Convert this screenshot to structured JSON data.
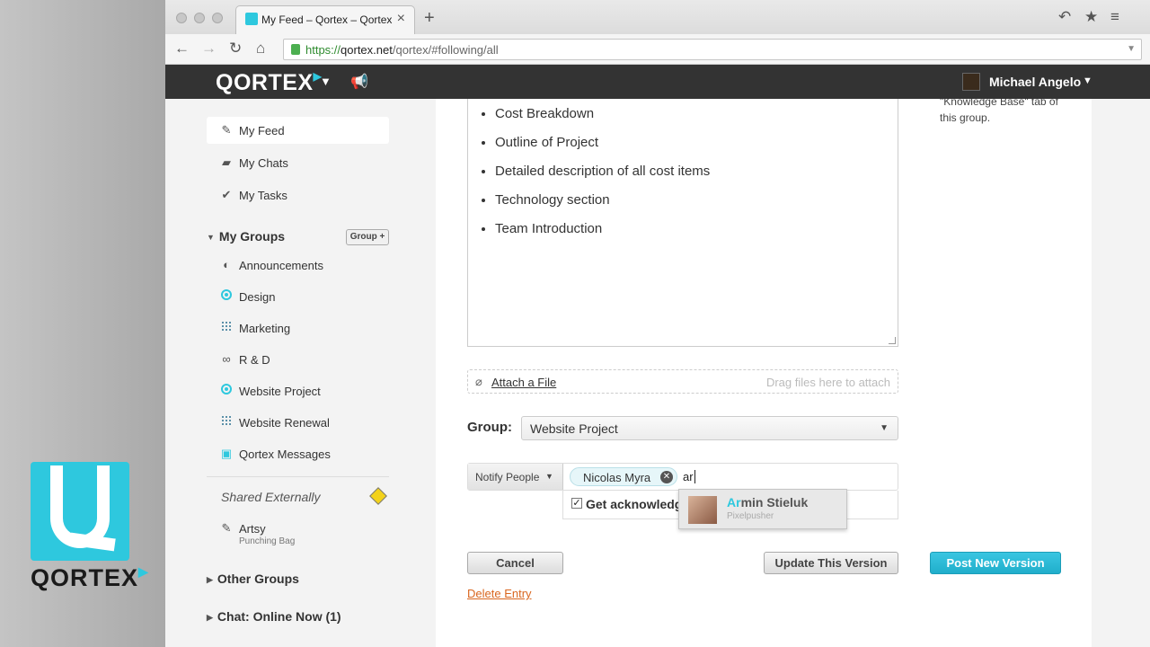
{
  "browser": {
    "tab_title": "My Feed – Qortex – Qortex",
    "url_scheme": "https://",
    "url_host": "qortex.net",
    "url_path": "/qortex/#following/all"
  },
  "app": {
    "logo": "QORTEX",
    "user_name": "Michael Angelo"
  },
  "sidebar": {
    "my_feed": "My Feed",
    "my_chats": "My Chats",
    "my_tasks": "My Tasks",
    "my_groups": "My Groups",
    "group_plus": "Group +",
    "groups": [
      {
        "label": "Announcements",
        "icon": "compass-icon"
      },
      {
        "label": "Design",
        "icon": "ring-icon"
      },
      {
        "label": "Marketing",
        "icon": "grid-icon"
      },
      {
        "label": "R & D",
        "icon": "glasses-icon"
      },
      {
        "label": "Website Project",
        "icon": "ring-icon"
      },
      {
        "label": "Website Renewal",
        "icon": "grid-icon"
      },
      {
        "label": "Qortex Messages",
        "icon": "qortex-icon"
      }
    ],
    "shared_externally": "Shared Externally",
    "artsy": "Artsy",
    "artsy_sub": "Punching Bag",
    "other_groups": "Other Groups",
    "chat_online": "Chat: Online Now (1)"
  },
  "editor": {
    "items": [
      "Cost Breakdown",
      "Outline of Project",
      "Detailed description of all cost items",
      "Technology section",
      "Team Introduction"
    ]
  },
  "attach": {
    "link": "Attach a File",
    "hint": "Drag files here to attach"
  },
  "group_field": {
    "label": "Group:",
    "value": "Website Project"
  },
  "notify": {
    "button": "Notify People",
    "token": "Nicolas Myra",
    "typed": "ar",
    "ack_label": "Get acknowledge"
  },
  "suggestion": {
    "match": "Ar",
    "rest": "min Stieluk",
    "role": "Pixelpusher"
  },
  "actions": {
    "cancel": "Cancel",
    "update": "Update This Version",
    "post": "Post New Version",
    "delete": "Delete Entry"
  },
  "right_note": {
    "line1": "\"Knowledge Base\" tab of",
    "line2": "this group."
  },
  "colors": {
    "brand": "#2ec8de",
    "header": "#333333",
    "link_orange": "#d9661f"
  }
}
